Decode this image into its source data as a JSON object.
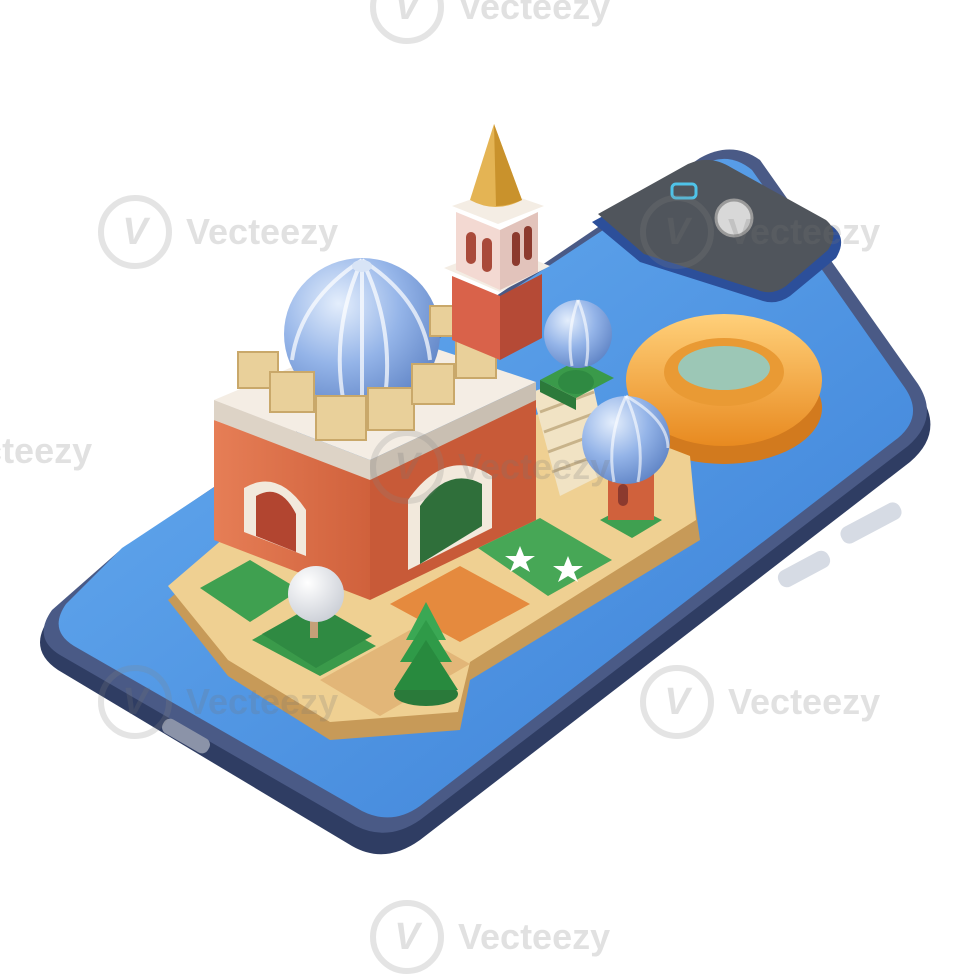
{
  "watermark": {
    "text": "Vecteezy",
    "logo_glyph": "V",
    "color": "#9a9a9a"
  },
  "scene": {
    "subject": "isometric-smartphone-with-3d-city-landmark",
    "colors": {
      "phone_frame": "#3c4b74",
      "screen": "#4a8fe0",
      "camera_bump": "#4f5358",
      "base": "#e9c07c",
      "wall": "#e0704a",
      "dome": "#8fb0e6",
      "tower_top": "#e0b250",
      "float_ring": "#f0a23a",
      "grass": "#3fa050",
      "tree": "#2f9a48"
    },
    "icons": [
      "dome-icon",
      "tower-icon",
      "arch-icon",
      "float-ring-icon",
      "tree-icon",
      "star-icon",
      "camera-icon"
    ]
  }
}
